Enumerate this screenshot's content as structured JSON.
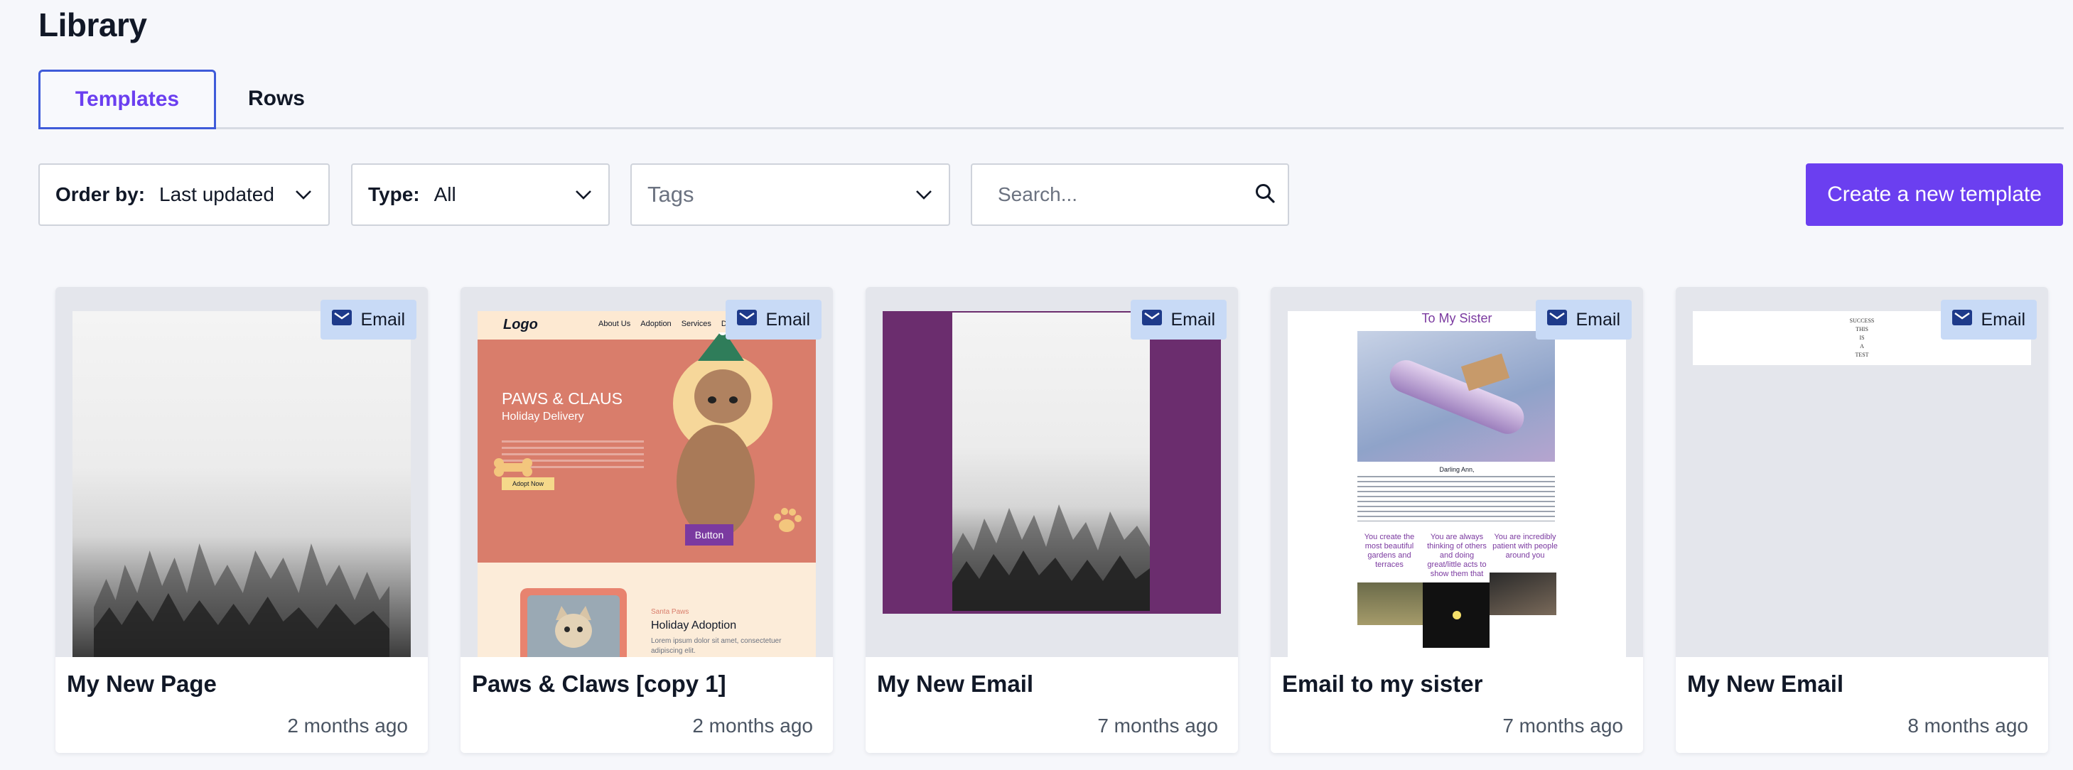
{
  "page": {
    "title": "Library"
  },
  "tabs": [
    {
      "label": "Templates",
      "active": true
    },
    {
      "label": "Rows",
      "active": false
    }
  ],
  "filters": {
    "order": {
      "label": "Order by:",
      "value": "Last updated"
    },
    "type": {
      "label": "Type:",
      "value": "All"
    },
    "tags": {
      "placeholder": "Tags"
    },
    "search": {
      "placeholder": "Search...",
      "value": ""
    }
  },
  "create_button": {
    "label": "Create a new template"
  },
  "cards": [
    {
      "title": "My New Page",
      "time": "2 months ago",
      "badge": "Email"
    },
    {
      "title": "Paws & Claws [copy 1]",
      "time": "2 months ago",
      "badge": "Email",
      "preview": {
        "logo": "Logo",
        "nav": [
          "About Us",
          "Adoption",
          "Services",
          "Don"
        ],
        "headline": "PAWS & CLAUS",
        "subhead": "Holiday Delivery",
        "cta": "Adopt Now",
        "button": "Button",
        "lower_kicker": "Santa Paws",
        "lower_title": "Holiday Adoption",
        "lower_body": "Lorem ipsum dolor sit amet, consectetuer adipiscing elit."
      }
    },
    {
      "title": "My New Email",
      "time": "7 months ago",
      "badge": "Email"
    },
    {
      "title": "Email to my sister",
      "time": "7 months ago",
      "badge": "Email",
      "preview": {
        "heading": "To My Sister",
        "greeting": "Darling Ann,",
        "col1": "You create the most beautiful gardens and terraces",
        "col2": "You are always thinking of others and doing great/little acts to show them that",
        "col3": "You are incredibly patient with people around you"
      }
    },
    {
      "title": "My New Email",
      "time": "8 months ago",
      "badge": "Email",
      "preview": {
        "lines": [
          "SUCCESS",
          "THIS",
          "IS",
          "A",
          "TEST"
        ]
      }
    }
  ],
  "colors": {
    "accent": "#6b3ff0",
    "tab_border": "#3f5bd9",
    "badge_bg": "#c8daf6",
    "email_purple": "#6b2d6e"
  }
}
